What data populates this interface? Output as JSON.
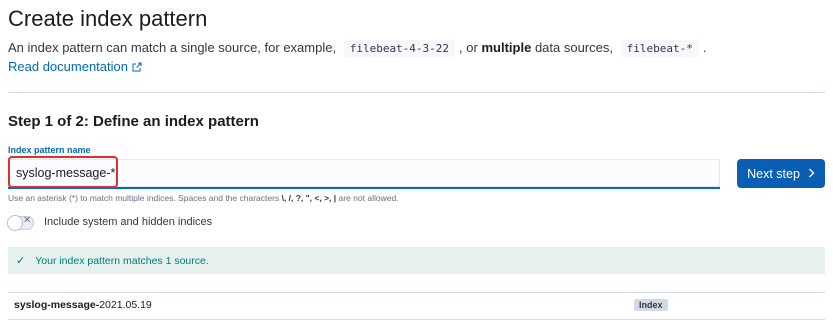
{
  "header": {
    "title": "Create index pattern",
    "description_prefix": "An index pattern can match a single source, for example,",
    "example_single": "filebeat-4-3-22",
    "description_mid": ", or",
    "description_bold": "multiple",
    "description_after_bold": "data sources,",
    "example_multi": "filebeat-*",
    "description_end": ".",
    "doc_link": "Read documentation"
  },
  "step": {
    "title": "Step 1 of 2: Define an index pattern",
    "field_label": "Index pattern name",
    "field_value": "syslog-message-*",
    "next_button": "Next step",
    "help_text_prefix": "Use an asterisk (*) to match multiple indices. Spaces and the characters",
    "help_text_chars": "\\, /, ?, \", <, >, |",
    "help_text_suffix": "are not allowed."
  },
  "toggle": {
    "label": "Include system and hidden indices",
    "checked": false
  },
  "callout": {
    "message": "Your index pattern matches 1 source."
  },
  "results": [
    {
      "name_bold": "syslog-message-",
      "name_rest": "2021.05.19",
      "badge": "Index"
    }
  ],
  "colors": {
    "primary": "#0a5fb5",
    "link": "#006bb8",
    "success_bg": "#e6f1ef",
    "success_text": "#017d73",
    "highlight": "#e0302b"
  },
  "icons": {
    "external_link": "popout-icon",
    "next": "chevron-right-icon",
    "check": "check-icon",
    "toggle_off": "cross-icon"
  }
}
